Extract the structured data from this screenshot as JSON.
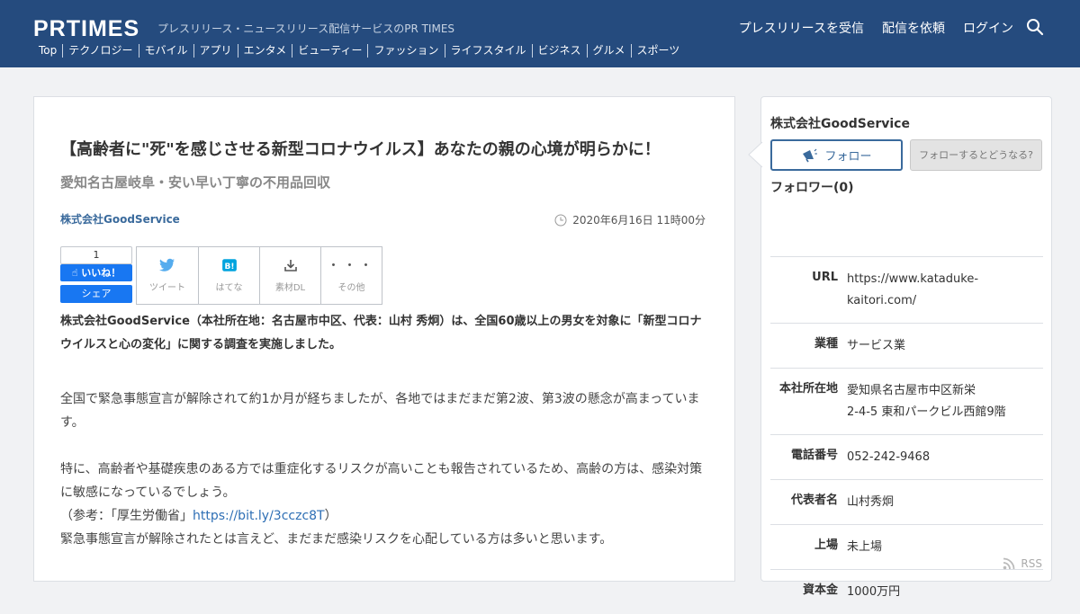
{
  "header": {
    "logo": "PRTIMES",
    "tagline": "プレスリリース・ニュースリリース配信サービスのPR TIMES",
    "links": [
      "プレスリリースを受信",
      "配信を依頼",
      "ログイン"
    ],
    "categories": [
      "Top",
      "テクノロジー",
      "モバイル",
      "アプリ",
      "エンタメ",
      "ビューティー",
      "ファッション",
      "ライフスタイル",
      "ビジネス",
      "グルメ",
      "スポーツ"
    ]
  },
  "article": {
    "title": "【高齢者に\"死\"を感じさせる新型コロナウイルス】あなたの親の心境が明らかに！",
    "subtitle": "愛知名古屋岐阜・安い早い丁寧の不用品回収",
    "company": "株式会社GoodService",
    "date": "2020年6月16日 11時00分",
    "fb": {
      "count": "1",
      "like": "いいね！",
      "share": "シェア"
    },
    "share_buttons": [
      "ツイート",
      "はてな",
      "素材DL",
      "その他"
    ],
    "lead": "株式会社GoodService（本社所在地：名古屋市中区、代表：山村 秀炯）は、全国60歳以上の男女を対象に「新型コロナウイルスと心の変化」に関する調査を実施しました。",
    "p1": "全国で緊急事態宣言が解除されて約1か月が経ちましたが、各地ではまだまだ第2波、第3波の懸念が高まっています。",
    "p2": "特に、高齢者や基礎疾患のある方では重症化するリスクが高いことも報告されているため、高齢の方は、感染対策に敏感になっているでしょう。",
    "ref_prefix": "（参考：「厚生労働省」",
    "ref_link": "https://bit.ly/3cczc8T",
    "ref_suffix": "）",
    "p3": "緊急事態宣言が解除されたとは言えど、まだまだ感染リスクを心配している方は多いと思います。"
  },
  "sidebar": {
    "company": "株式会社GoodService",
    "follow": "フォロー",
    "what": "フォローするとどうなる?",
    "followers": "フォロワー(0)",
    "info": [
      {
        "label": "URL",
        "value": "https://www.kataduke-kaitori.com/"
      },
      {
        "label": "業種",
        "value": "サービス業"
      },
      {
        "label": "本社所在地",
        "value": "愛知県名古屋市中区新栄",
        "value2": "2-4-5 東和パークビル西館9階"
      },
      {
        "label": "電話番号",
        "value": "052-242-9468"
      },
      {
        "label": "代表者名",
        "value": "山村秀炯"
      },
      {
        "label": "上場",
        "value": "未上場"
      },
      {
        "label": "資本金",
        "value": "1000万円"
      }
    ],
    "rss": "RSS"
  },
  "colors": {
    "header_bg": "#254b7e",
    "link": "#3a6a9c",
    "facebook": "#1877f2"
  }
}
